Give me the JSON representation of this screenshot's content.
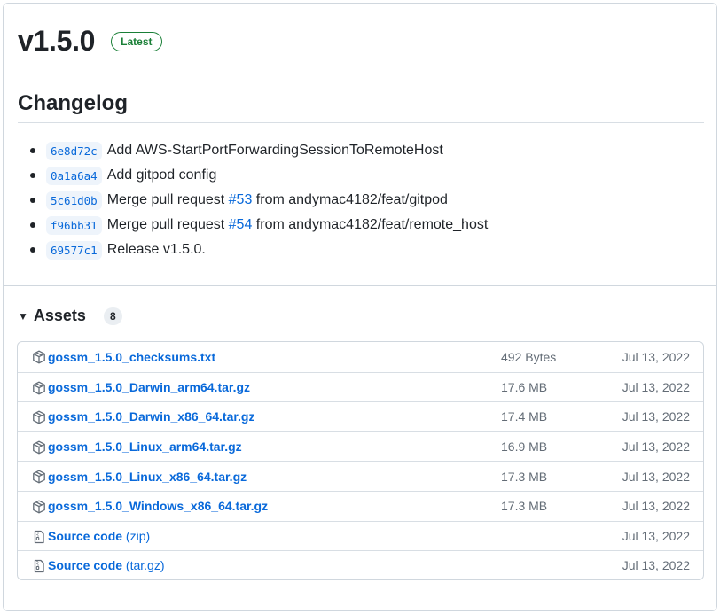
{
  "release": {
    "version": "v1.5.0",
    "badge": "Latest"
  },
  "changelog": {
    "title": "Changelog",
    "items": [
      {
        "sha": "6e8d72c",
        "before": "Add AWS-StartPortForwardingSessionToRemoteHost",
        "pr": "",
        "after": ""
      },
      {
        "sha": "0a1a6a4",
        "before": "Add gitpod config",
        "pr": "",
        "after": ""
      },
      {
        "sha": "5c61d0b",
        "before": "Merge pull request ",
        "pr": "#53",
        "after": " from andymac4182/feat/gitpod"
      },
      {
        "sha": "f96bb31",
        "before": "Merge pull request ",
        "pr": "#54",
        "after": " from andymac4182/feat/remote_host"
      },
      {
        "sha": "69577c1",
        "before": "Release v1.5.0.",
        "pr": "",
        "after": ""
      }
    ]
  },
  "assets": {
    "title": "Assets",
    "count": "8",
    "items": [
      {
        "name": "gossm_1.5.0_checksums.txt",
        "suffix": "",
        "size": "492 Bytes",
        "date": "Jul 13, 2022",
        "icon": "package-icon"
      },
      {
        "name": "gossm_1.5.0_Darwin_arm64.tar.gz",
        "suffix": "",
        "size": "17.6 MB",
        "date": "Jul 13, 2022",
        "icon": "package-icon"
      },
      {
        "name": "gossm_1.5.0_Darwin_x86_64.tar.gz",
        "suffix": "",
        "size": "17.4 MB",
        "date": "Jul 13, 2022",
        "icon": "package-icon"
      },
      {
        "name": "gossm_1.5.0_Linux_arm64.tar.gz",
        "suffix": "",
        "size": "16.9 MB",
        "date": "Jul 13, 2022",
        "icon": "package-icon"
      },
      {
        "name": "gossm_1.5.0_Linux_x86_64.tar.gz",
        "suffix": "",
        "size": "17.3 MB",
        "date": "Jul 13, 2022",
        "icon": "package-icon"
      },
      {
        "name": "gossm_1.5.0_Windows_x86_64.tar.gz",
        "suffix": "",
        "size": "17.3 MB",
        "date": "Jul 13, 2022",
        "icon": "package-icon"
      },
      {
        "name": "Source code",
        "suffix": " (zip)",
        "size": "",
        "date": "Jul 13, 2022",
        "icon": "file-zip-icon"
      },
      {
        "name": "Source code",
        "suffix": " (tar.gz)",
        "size": "",
        "date": "Jul 13, 2022",
        "icon": "file-zip-icon"
      }
    ]
  },
  "colors": {
    "link": "#0969da",
    "latest": "#1a7f37",
    "border": "#d0d7de",
    "muted": "#636c76"
  }
}
